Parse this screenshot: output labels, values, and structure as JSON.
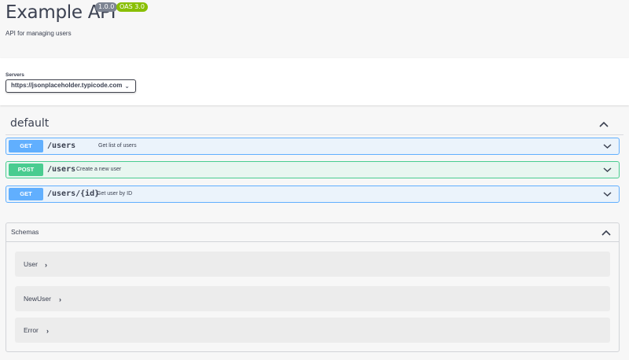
{
  "info": {
    "title": "Example API",
    "version": "1.0.0",
    "oas": "OAS 3.0",
    "description": "API for managing users"
  },
  "servers": {
    "label": "Servers",
    "selected": "https://jsonplaceholder.typicode.com"
  },
  "tag": {
    "name": "default"
  },
  "operations": [
    {
      "method": "GET",
      "path": "/users",
      "summary": "Get list of users"
    },
    {
      "method": "POST",
      "path": "/users",
      "summary": "Create a new user"
    },
    {
      "method": "GET",
      "path": "/users/{id}",
      "summary": "Get user by ID"
    }
  ],
  "schemas": {
    "title": "Schemas",
    "models": [
      "User",
      "NewUser",
      "Error"
    ]
  },
  "colors": {
    "get": "#61affe",
    "post": "#49cc90",
    "version_badge": "#7d8492",
    "oas_badge": "#89bf04"
  },
  "icons": {
    "collapse": "chevron-up-icon",
    "expand": "chevron-down-icon",
    "model_expand": "chevron-right-icon"
  }
}
